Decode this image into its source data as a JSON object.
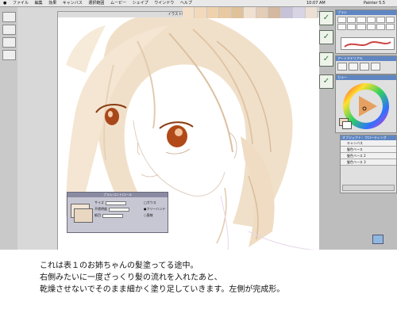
{
  "menubar": {
    "items": [
      "ファイル",
      "編集",
      "効果",
      "キャンバス",
      "選択範囲",
      "ムービー",
      "シェイプ",
      "ウインドウ",
      "ヘルプ"
    ],
    "clock": "10:07 AM",
    "app": "Painter 5.5"
  },
  "document": {
    "title": "イラスト作成.psd @ 66%"
  },
  "color_swatches": [
    "#f4dfc8",
    "#f2d9bb",
    "#eed2ae",
    "#e8c9a2",
    "#dfc19a",
    "#f0e0d0",
    "#e4cdb6",
    "#d4b8a0",
    "#c7c2d8",
    "#d9d3e6",
    "#ece0d4"
  ],
  "brush_controls": {
    "title": "ブラシコントロール",
    "size_label": "サイズ",
    "opacity_label": "不透明度",
    "grain_label": "紙目",
    "opt1": "ガウス",
    "opt2": "フリーハンド",
    "opt3": "直線"
  },
  "palettes": {
    "brushes_title": "ブラシ",
    "art_materials_title": "アートマテリアル",
    "color_title": "カラー",
    "layers_title": "オブジェクト：フローティング",
    "layers": [
      "キャンバス",
      "髪色ベース",
      "髪色ベース 2",
      "髪色ベース 3"
    ]
  },
  "caption": {
    "line1": "これは表１のお姉ちゃんの髪塗ってる途中。",
    "line2": "右側みたいに一度ざっくり髪の流れを入れたあと、",
    "line3": "乾燥させないでそのまま細かく塗り足していきます。左側が完成形。"
  }
}
